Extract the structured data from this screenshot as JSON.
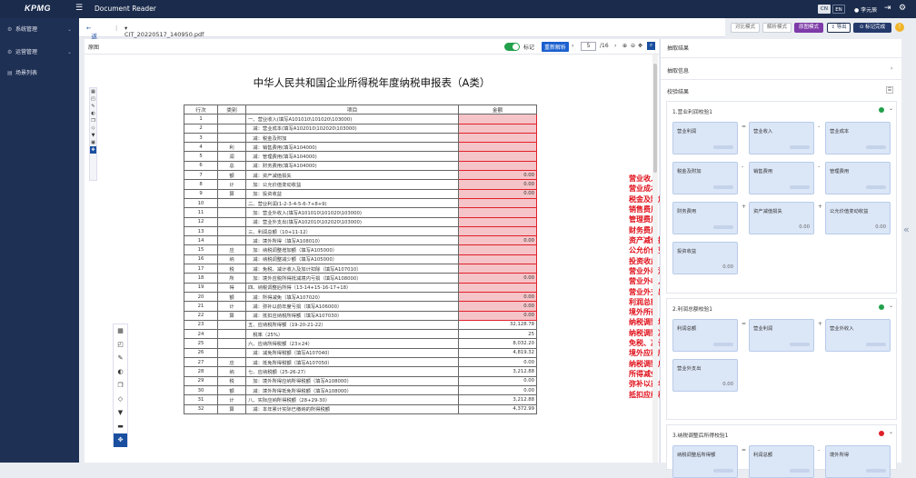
{
  "topbar": {
    "logo": "KPMG",
    "app_title": "Document Reader",
    "lang_cn": "CN",
    "lang_en": "EN",
    "user": "李元辰"
  },
  "sidebar": {
    "items": [
      {
        "label": "系统管理",
        "icon": "gear-icon"
      },
      {
        "label": "运营管理",
        "icon": "cog-icon"
      },
      {
        "label": "场景列表",
        "icon": "list-icon"
      }
    ]
  },
  "breadcrumb": {
    "back": "返回",
    "file": "CIT_20220517_140950.pdf"
  },
  "toolbar": {
    "compare_mode": "对比模式",
    "parse_mode": "解析模式",
    "source_mode": "原图模式",
    "export": "导出",
    "save": "标记完成"
  },
  "viewer": {
    "section": "原图",
    "mark_label": "标记",
    "reparse": "重新解析",
    "page_current": "5",
    "page_total": "/16"
  },
  "document": {
    "title": "中华人民共和国企业所得税年度纳税申报表（A类）",
    "headers": [
      "行次",
      "类别",
      "项目",
      "金额"
    ],
    "rows": [
      {
        "n": "1",
        "cat": "",
        "item": "一、营业收入(填写A101010\\101020\\103000)",
        "amt": "",
        "hl": true
      },
      {
        "n": "2",
        "cat": "",
        "item": "　减：营业成本(填写A102010\\102020\\103000)",
        "amt": "",
        "hl": true
      },
      {
        "n": "3",
        "cat": "",
        "item": "　减：税金及附加",
        "amt": "",
        "hl": true
      },
      {
        "n": "4",
        "cat": "利",
        "item": "　减：销售费用(填写A104000)",
        "amt": "",
        "hl": true
      },
      {
        "n": "5",
        "cat": "润",
        "item": "　减：管理费用(填写A104000)",
        "amt": "",
        "hl": true
      },
      {
        "n": "6",
        "cat": "总",
        "item": "　减：财务费用(填写A104000)",
        "amt": "",
        "hl": true
      },
      {
        "n": "7",
        "cat": "额",
        "item": "　减：资产减值损失",
        "amt": "0.00",
        "hl": true
      },
      {
        "n": "8",
        "cat": "计",
        "item": "　加：公允价值变动收益",
        "amt": "0.00",
        "hl": true
      },
      {
        "n": "9",
        "cat": "算",
        "item": "　加：投资收益",
        "amt": "0.00",
        "hl": true
      },
      {
        "n": "10",
        "cat": "",
        "item": "二、营业利润(1-2-3-4-5-6-7+8+9)",
        "amt": "",
        "hl": true
      },
      {
        "n": "11",
        "cat": "",
        "item": "　加：营业外收入(填写A101010\\101020\\103000)",
        "amt": "",
        "hl": true
      },
      {
        "n": "12",
        "cat": "",
        "item": "　减：营业外支出(填写A102010\\102020\\103000)",
        "amt": "",
        "hl": true
      },
      {
        "n": "13",
        "cat": "",
        "item": "三、利润总额（10+11-12）",
        "amt": "",
        "hl": true
      },
      {
        "n": "14",
        "cat": "",
        "item": "　减：境外所得（填写A108010）",
        "amt": "0.00",
        "hl": true
      },
      {
        "n": "15",
        "cat": "应",
        "item": "　加：纳税调整增加额（填写A105000）",
        "amt": "",
        "hl": true
      },
      {
        "n": "16",
        "cat": "纳",
        "item": "　减：纳税调整减少额（填写A105000）",
        "amt": "",
        "hl": true
      },
      {
        "n": "17",
        "cat": "税",
        "item": "　减：免税、减计收入及加计扣除（填写A107010）",
        "amt": "",
        "hl": true
      },
      {
        "n": "18",
        "cat": "所",
        "item": "　加：境外应税所得抵减境内亏损（填写A108000）",
        "amt": "0.00",
        "hl": true
      },
      {
        "n": "19",
        "cat": "得",
        "item": "四、纳税调整后所得（13-14+15-16-17+18）",
        "amt": "",
        "hl": true
      },
      {
        "n": "20",
        "cat": "额",
        "item": "　减：所得减免（填写A107020）",
        "amt": "0.00",
        "hl": true
      },
      {
        "n": "21",
        "cat": "计",
        "item": "　减：弥补以前年度亏损（填写A106000）",
        "amt": "0.00",
        "hl": true
      },
      {
        "n": "22",
        "cat": "算",
        "item": "　减：抵扣应纳税所得额（填写A107030）",
        "amt": "0.00",
        "hl": true
      },
      {
        "n": "23",
        "cat": "",
        "item": "五、应纳税所得额（19-20-21-22）",
        "amt": "32,128.78",
        "hl": false
      },
      {
        "n": "24",
        "cat": "",
        "item": "　税率（25%）",
        "amt": "25",
        "hl": false
      },
      {
        "n": "25",
        "cat": "",
        "item": "六、应纳所得税额（23×24）",
        "amt": "8,032.20",
        "hl": false
      },
      {
        "n": "26",
        "cat": "",
        "item": "　减：减免所得税额（填写A107040）",
        "amt": "4,819.32",
        "hl": false
      },
      {
        "n": "27",
        "cat": "应",
        "item": "　减：抵免所得税额（填写A107050）",
        "amt": "0.00",
        "hl": false
      },
      {
        "n": "28",
        "cat": "纳",
        "item": "七、应纳税额（25-26-27）",
        "amt": "3,212.88",
        "hl": false
      },
      {
        "n": "29",
        "cat": "税",
        "item": "　加：境外所得应纳所得税额（填写A108000）",
        "amt": "0.00",
        "hl": false
      },
      {
        "n": "30",
        "cat": "额",
        "item": "　减：境外所得抵免所得税额（填写A108000）",
        "amt": "0.00",
        "hl": false
      },
      {
        "n": "31",
        "cat": "计",
        "item": "八、实际应纳所得税额（28+29-30）",
        "amt": "3,212.88",
        "hl": false
      },
      {
        "n": "32",
        "cat": "算",
        "item": "　减：本年累计实际已缴纳的所得税额",
        "amt": "4,372.99",
        "hl": false
      }
    ],
    "annotations": [
      "营业收入",
      "营业成本",
      "税金及附加",
      "销售费用",
      "管理费用",
      "财务费用",
      "资产减值损失",
      "公允价值变动收益",
      "投资收益",
      "营业外利润",
      "营业外收入",
      "营业外支出",
      "利润总额",
      "境外所得",
      "纳税调整增加额",
      "纳税调整减少额",
      "免税、减计收入及加计扣除",
      "境外应税所得抵减境内亏损",
      "纳税调整后所得",
      "所得减免",
      "弥补以前年度亏损",
      "抵扣应纳税所得额"
    ]
  },
  "right_panel": {
    "header": "抽取结果",
    "extract_info": "抽取信息",
    "check_results": "校验结果",
    "groups": [
      {
        "title": "1.营业利润校验1",
        "status": "pass",
        "status_color": "#22a04b",
        "cards": [
          {
            "label": "营业利润",
            "value": ""
          },
          {
            "label": "营业收入",
            "value": ""
          },
          {
            "label": "营业成本",
            "value": ""
          },
          {
            "label": "税金及附加",
            "value": ""
          },
          {
            "label": "销售费用",
            "value": ""
          },
          {
            "label": "管理费用",
            "value": ""
          },
          {
            "label": "财务费用",
            "value": ""
          },
          {
            "label": "资产减值损失",
            "value": "0.00"
          },
          {
            "label": "公允价值变动收益",
            "value": "0.00"
          },
          {
            "label": "投资收益",
            "value": "0.00"
          }
        ]
      },
      {
        "title": "2.利润总额校验1",
        "status": "pass",
        "status_color": "#22a04b",
        "cards": [
          {
            "label": "利润总额",
            "value": ""
          },
          {
            "label": "营业利润",
            "value": ""
          },
          {
            "label": "营业外收入",
            "value": ""
          },
          {
            "label": "营业外支出",
            "value": "0.00"
          }
        ]
      },
      {
        "title": "3.纳税调整后所得校验1",
        "status": "fail",
        "status_color": "#e0202a",
        "cards": [
          {
            "label": "纳税调整后所得额",
            "value": ""
          },
          {
            "label": "利润总额",
            "value": ""
          },
          {
            "label": "境外所得",
            "value": ""
          }
        ]
      }
    ]
  }
}
